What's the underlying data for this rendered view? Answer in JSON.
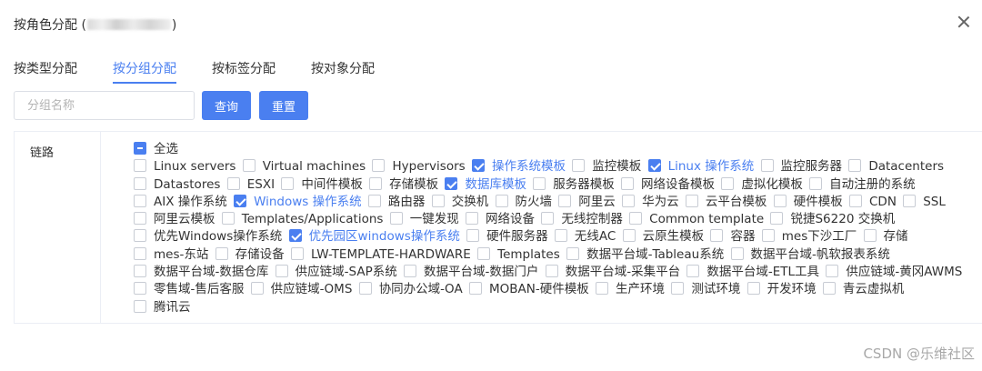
{
  "dialog": {
    "title_prefix": "按角色分配 (",
    "title_suffix": ")",
    "close_icon": "close-icon"
  },
  "tabs": [
    {
      "label": "按类型分配",
      "active": false
    },
    {
      "label": "按分组分配",
      "active": true
    },
    {
      "label": "按标签分配",
      "active": false
    },
    {
      "label": "按对象分配",
      "active": false
    }
  ],
  "search": {
    "placeholder": "分组名称",
    "value": "",
    "query_label": "查询",
    "reset_label": "重置"
  },
  "table": {
    "row_label": "链路",
    "rows": [
      [
        {
          "label": "全选",
          "state": "indeterminate"
        }
      ],
      [
        {
          "label": "Linux servers",
          "state": "unchecked"
        },
        {
          "label": "Virtual machines",
          "state": "unchecked"
        },
        {
          "label": "Hypervisors",
          "state": "unchecked"
        },
        {
          "label": "操作系统模板",
          "state": "checked"
        },
        {
          "label": "监控模板",
          "state": "unchecked"
        },
        {
          "label": "Linux 操作系统",
          "state": "checked"
        },
        {
          "label": "监控服务器",
          "state": "unchecked"
        },
        {
          "label": "Datacenters",
          "state": "unchecked"
        }
      ],
      [
        {
          "label": "Datastores",
          "state": "unchecked"
        },
        {
          "label": "ESXI",
          "state": "unchecked"
        },
        {
          "label": "中间件模板",
          "state": "unchecked"
        },
        {
          "label": "存储模板",
          "state": "unchecked"
        },
        {
          "label": "数据库模板",
          "state": "checked"
        },
        {
          "label": "服务器模板",
          "state": "unchecked"
        },
        {
          "label": "网络设备模板",
          "state": "unchecked"
        },
        {
          "label": "虚拟化模板",
          "state": "unchecked"
        },
        {
          "label": "自动注册的系统",
          "state": "unchecked"
        }
      ],
      [
        {
          "label": "AIX 操作系统",
          "state": "unchecked"
        },
        {
          "label": "Windows 操作系统",
          "state": "checked"
        },
        {
          "label": "路由器",
          "state": "unchecked"
        },
        {
          "label": "交换机",
          "state": "unchecked"
        },
        {
          "label": "防火墙",
          "state": "unchecked"
        },
        {
          "label": "阿里云",
          "state": "unchecked"
        },
        {
          "label": "华为云",
          "state": "unchecked"
        },
        {
          "label": "云平台模板",
          "state": "unchecked"
        },
        {
          "label": "硬件模板",
          "state": "unchecked"
        },
        {
          "label": "CDN",
          "state": "unchecked"
        },
        {
          "label": "SSL",
          "state": "unchecked"
        }
      ],
      [
        {
          "label": "阿里云模板",
          "state": "unchecked"
        },
        {
          "label": "Templates/Applications",
          "state": "unchecked"
        },
        {
          "label": "一键发现",
          "state": "unchecked"
        },
        {
          "label": "网络设备",
          "state": "unchecked"
        },
        {
          "label": "无线控制器",
          "state": "unchecked"
        },
        {
          "label": "Common template",
          "state": "unchecked"
        },
        {
          "label": "锐捷S6220 交换机",
          "state": "unchecked"
        }
      ],
      [
        {
          "label": "优先Windows操作系统",
          "state": "unchecked"
        },
        {
          "label": "优先园区windows操作系统",
          "state": "checked"
        },
        {
          "label": "硬件服务器",
          "state": "unchecked"
        },
        {
          "label": "无线AC",
          "state": "unchecked"
        },
        {
          "label": "云原生模板",
          "state": "unchecked"
        },
        {
          "label": "容器",
          "state": "unchecked"
        },
        {
          "label": "mes下沙工厂",
          "state": "unchecked"
        },
        {
          "label": "存储",
          "state": "unchecked"
        }
      ],
      [
        {
          "label": "mes-东站",
          "state": "unchecked"
        },
        {
          "label": "存储设备",
          "state": "unchecked"
        },
        {
          "label": "LW-TEMPLATE-HARDWARE",
          "state": "unchecked"
        },
        {
          "label": "Templates",
          "state": "unchecked"
        },
        {
          "label": "数据平台域-Tableau系统",
          "state": "unchecked"
        },
        {
          "label": "数据平台域-帆软报表系统",
          "state": "unchecked"
        }
      ],
      [
        {
          "label": "数据平台域-数据仓库",
          "state": "unchecked"
        },
        {
          "label": "供应链域-SAP系统",
          "state": "unchecked"
        },
        {
          "label": "数据平台域-数据门户",
          "state": "unchecked"
        },
        {
          "label": "数据平台域-采集平台",
          "state": "unchecked"
        },
        {
          "label": "数据平台域-ETL工具",
          "state": "unchecked"
        },
        {
          "label": "供应链域-黄冈AWMS",
          "state": "unchecked"
        }
      ],
      [
        {
          "label": "零售域-售后客服",
          "state": "unchecked"
        },
        {
          "label": "供应链域-OMS",
          "state": "unchecked"
        },
        {
          "label": "协同办公域-OA",
          "state": "unchecked"
        },
        {
          "label": "MOBAN-硬件模板",
          "state": "unchecked"
        },
        {
          "label": "生产环境",
          "state": "unchecked"
        },
        {
          "label": "测试环境",
          "state": "unchecked"
        },
        {
          "label": "开发环境",
          "state": "unchecked"
        },
        {
          "label": "青云虚拟机",
          "state": "unchecked"
        }
      ],
      [
        {
          "label": "腾讯云",
          "state": "unchecked"
        }
      ]
    ]
  },
  "watermark": "CSDN @乐维社区",
  "colors": {
    "accent": "#4a7ff0",
    "border": "#ebeef5",
    "text": "#333333"
  }
}
